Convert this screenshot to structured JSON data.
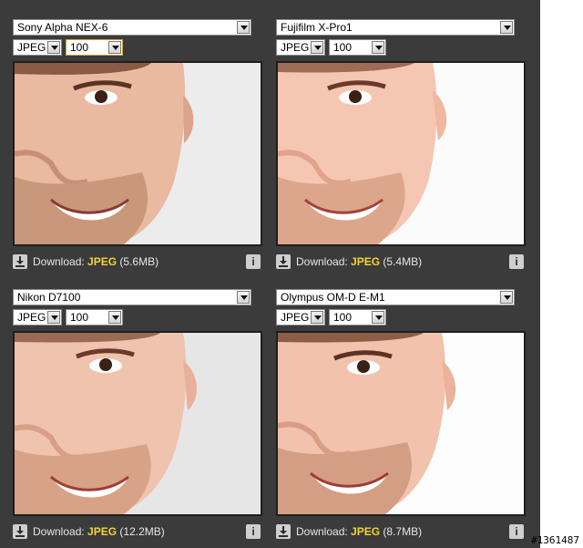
{
  "panels": [
    {
      "camera": "Sony Alpha NEX-6",
      "format": "JPEG",
      "quality": "100",
      "download_label": "Download:",
      "download_format": "JPEG",
      "download_size": "(5.6MB)",
      "info_label": "i"
    },
    {
      "camera": "Fujifilm X-Pro1",
      "format": "JPEG",
      "quality": "100",
      "download_label": "Download:",
      "download_format": "JPEG",
      "download_size": "(5.4MB)",
      "info_label": "i"
    },
    {
      "camera": "Nikon D7100",
      "format": "JPEG",
      "quality": "100",
      "download_label": "Download:",
      "download_format": "JPEG",
      "download_size": "(12.2MB)",
      "info_label": "i"
    },
    {
      "camera": "Olympus OM-D E-M1",
      "format": "JPEG",
      "quality": "100",
      "download_label": "Download:",
      "download_format": "JPEG",
      "download_size": "(8.7MB)",
      "info_label": "i"
    }
  ],
  "watermark": "#1361487",
  "colors": {
    "panel_bg": "#3b3b3b",
    "link": "#f3d23c",
    "label": "#e6e6e6"
  }
}
